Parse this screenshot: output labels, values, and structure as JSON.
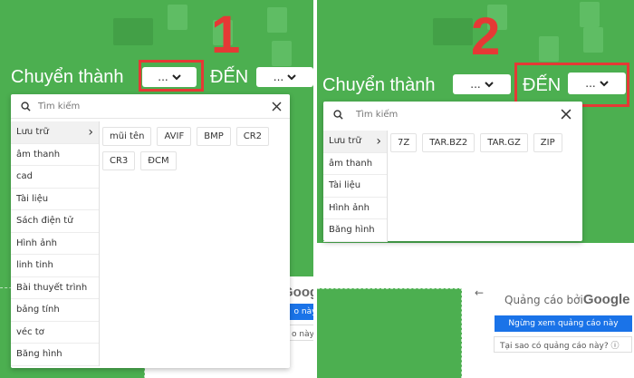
{
  "colors": {
    "bg_green": "#4caf50",
    "annotation_red": "#e53935",
    "ad_blue": "#1a73e8"
  },
  "panel1": {
    "step_number": "1",
    "convert_label": "Chuyển thành",
    "from_select": "...",
    "to_label": "ĐẾN",
    "to_select": "...",
    "search_placeholder": "Tìm kiếm",
    "categories": [
      {
        "label": "Lưu trữ",
        "arrow": "›"
      },
      {
        "label": "âm thanh"
      },
      {
        "label": "cad"
      },
      {
        "label": "Tài liệu"
      },
      {
        "label": "Sách điện tử"
      },
      {
        "label": "Hình ảnh"
      },
      {
        "label": "linh tinh"
      },
      {
        "label": "Bài thuyết trình"
      },
      {
        "label": "bảng tính"
      },
      {
        "label": "véc tơ"
      },
      {
        "label": "Băng hình"
      }
    ],
    "formats": [
      "mũi tên",
      "AVIF",
      "BMP",
      "CR2",
      "CR3",
      "ĐCM"
    ],
    "ad_partial": "Googl",
    "ad_stop_partial": "o này",
    "ad_why_partial": "o này? ⓘ"
  },
  "panel2": {
    "step_number": "2",
    "convert_label": "Chuyển thành",
    "from_select": "...",
    "to_label": "ĐẾN",
    "to_select": "...",
    "search_placeholder": "Tìm kiếm",
    "categories": [
      {
        "label": "Lưu trữ",
        "arrow": "›"
      },
      {
        "label": "âm thanh"
      },
      {
        "label": "Tài liệu"
      },
      {
        "label": "Hình ảnh"
      },
      {
        "label": "Băng hình"
      }
    ],
    "formats": [
      "7Z",
      "TAR.BZ2",
      "TAR.GZ",
      "ZIP"
    ],
    "ad_title_prefix": "Quảng cáo bởi",
    "ad_title_brand": "Google",
    "ad_stop_button": "Ngừng xem quảng cáo này",
    "ad_why_button": "Tại sao có quảng cáo này? ⓘ",
    "ad_back": "←"
  }
}
